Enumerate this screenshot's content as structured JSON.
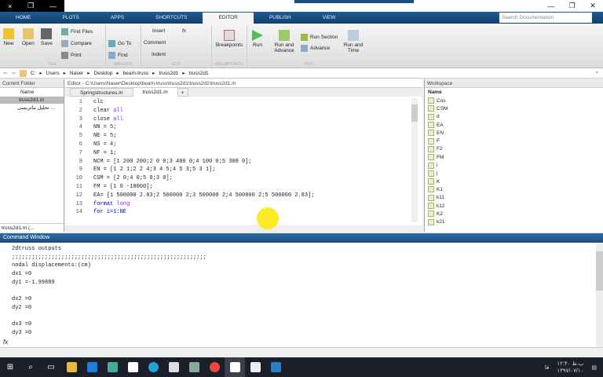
{
  "window": {
    "controls": [
      "×",
      "❐",
      "—"
    ],
    "right_controls": [
      "—",
      "❐",
      "✕"
    ]
  },
  "tabs": [
    "HOME",
    "PLOTS",
    "APPS",
    "SHORTCUTS",
    "EDITOR",
    "PUBLISH",
    "VIEW"
  ],
  "search_placeholder": "Search Documentation",
  "toolstrip": {
    "file": {
      "label": "FILE",
      "new": "New",
      "open": "Open",
      "save": "Save",
      "find_files": "Find Files",
      "compare": "Compare",
      "print": "Print"
    },
    "navigate": {
      "label": "NAVIGATE",
      "goto": "Go To",
      "find": "Find"
    },
    "edit": {
      "label": "EDIT",
      "insert": "Insert",
      "comment": "Comment",
      "indent": "Indent"
    },
    "breakpoints": {
      "label": "BREAKPOINTS",
      "breakpoints": "Breakpoints"
    },
    "run": {
      "label": "RUN",
      "run": "Run",
      "run_advance": "Run and Advance",
      "run_section": "Run Section",
      "advance": "Advance",
      "run_time": "Run and Time"
    }
  },
  "address": [
    "C:",
    "Users",
    "Naser",
    "Desktop",
    "beam-truss",
    "truss2d1",
    "truss2d1"
  ],
  "current_folder": {
    "title": "Current Folder",
    "col": "Name",
    "files": [
      "truss2d1.m",
      "تحلیل ماتریسی ..."
    ],
    "footer": "truss2d1.m (..."
  },
  "editor": {
    "title": "Editor - C:\\Users\\Naser\\Desktop\\beam-truss\\truss2d1\\truss2d1\\truss2d1.m",
    "tabs": [
      "Springstructures.m",
      "truss2d1.m",
      "+"
    ],
    "lines": [
      {
        "n": "1",
        "code": "clc"
      },
      {
        "n": "2",
        "code": "clear ",
        "arg": "all"
      },
      {
        "n": "3",
        "code": "close ",
        "arg": "all"
      },
      {
        "n": "4",
        "code": "NN = 5;"
      },
      {
        "n": "5",
        "code": "NE = 5;"
      },
      {
        "n": "6",
        "code": "NS = 4;"
      },
      {
        "n": "7",
        "code": "NF = 1;"
      },
      {
        "n": "8",
        "code": "NCM = [1 200 200;2 0 0;3 400 0;4 100 0;5 300 0];"
      },
      {
        "n": "9",
        "code": "EN = [1 2 1;2 2 4;3 4 5;4 5 3;5 3 1];"
      },
      {
        "n": "10",
        "code": "CSM = [2 0;4 0;5 0;3 0];"
      },
      {
        "n": "11",
        "code": "FM = [1 0 -10000];"
      },
      {
        "n": "12",
        "code": "EA= [1 500000 2.83;2 500000 2;3 500000 2;4 500000 2;5 500000 2.83];"
      },
      {
        "n": "13",
        "code": "format ",
        "arg": "long"
      },
      {
        "n": "14",
        "code": "for i=1:NE"
      }
    ]
  },
  "workspace": {
    "title": "Workspace",
    "col": "Name",
    "vars": [
      "Cos",
      "CSM",
      "d",
      "EA",
      "EN",
      "F",
      "F2",
      "FM",
      "i",
      "j",
      "K",
      "K1",
      "k11",
      "k12",
      "K2",
      "k21"
    ]
  },
  "command_window": {
    "title": "Command Window",
    "lines": [
      "2dtruss outputs",
      ";;;;;;;;;;;;;;;;;;;;;;;;;;;;;;;;;;;;;;;;;;;;;;;;;;;;;;;;;;;",
      "nodal displacements:(cm)",
      "dx1 =0",
      "dy1 =-1.99889",
      "",
      "dx2 =0",
      "dy2 =0",
      "",
      "dx3 =0",
      "dy3 =0"
    ],
    "prompt": "fx"
  },
  "taskbar": {
    "time": "۱۲:۴۰ ب.ظ",
    "date": "۱۳۹۷/۰۷/۱۰",
    "lang": "فا"
  }
}
